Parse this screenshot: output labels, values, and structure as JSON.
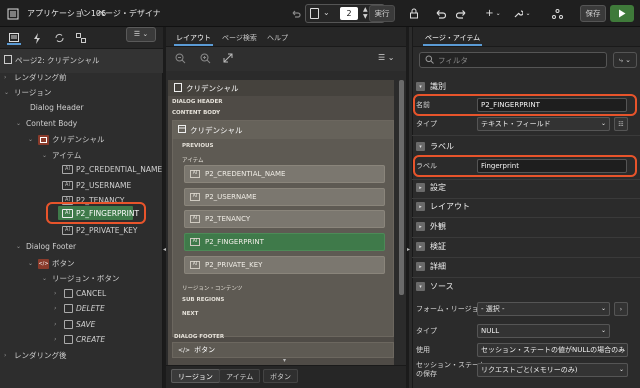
{
  "app": {
    "breadcrumb_app": "アプリケーション106",
    "breadcrumb_sep": "\\",
    "breadcrumb_tool": "ページ・デザイナ",
    "page_number": "2",
    "run_label": "実行",
    "save_label": "保存"
  },
  "left": {
    "page_title": "ページ2: クリデンシャル",
    "tree": {
      "before_render": "レンダリング前",
      "regions": "リージョン",
      "dialog_header": "Dialog Header",
      "content_body": "Content Body",
      "credential": "クリデンシャル",
      "items_label": "アイテム",
      "items": [
        "P2_CREDENTIAL_NAME",
        "P2_USERNAME",
        "P2_TENANCY",
        "P2_FINGERPRINT",
        "P2_PRIVATE_KEY"
      ],
      "dialog_footer": "Dialog Footer",
      "buttons_label": "ボタン",
      "region_buttons": "リージョン・ボタン",
      "buttons": [
        "CANCEL",
        "DELETE",
        "SAVE",
        "CREATE"
      ],
      "after_render": "レンダリング後"
    }
  },
  "middle": {
    "tabs": [
      "レイアウト",
      "ページ検索",
      "ヘルプ"
    ],
    "layout_title": "クリデンシャル",
    "dialog_header": "DIALOG HEADER",
    "content_body": "CONTENT BODY",
    "region_title": "クリデンシャル",
    "previous": "PREVIOUS",
    "items_caption": "アイテム",
    "items": [
      "P2_CREDENTIAL_NAME",
      "P2_USERNAME",
      "P2_TENANCY",
      "P2_FINGERPRINT",
      "P2_PRIVATE_KEY"
    ],
    "region_content": "リージョン・コンテンツ",
    "sub_regions": "SUB REGIONS",
    "next": "NEXT",
    "dialog_footer": "DIALOG FOOTER",
    "footer_button": "ボタン",
    "bottom_tabs": [
      "リージョン",
      "アイテム",
      "ボタン"
    ]
  },
  "right": {
    "tab": "ページ・アイテム",
    "filter_placeholder": "フィルタ",
    "groups": {
      "identification": "識別",
      "label": "ラベル",
      "settings": "設定",
      "layout": "レイアウト",
      "appearance": "外観",
      "validation": "検証",
      "advanced": "詳細",
      "source": "ソース"
    },
    "props": {
      "name_label": "名前",
      "name_value": "P2_FINGERPRINT",
      "type_label": "タイプ",
      "type_value": "テキスト・フィールド",
      "label_label": "ラベル",
      "label_value": "Fingerprint",
      "form_region_label": "フォーム・リージョン",
      "form_region_value": "- 選択 -",
      "source_type_label": "タイプ",
      "source_type_value": "NULL",
      "used_label": "使用",
      "used_value": "セッション・ステートの値がNULLの場合のみ",
      "session_label_1": "セッション・ステート",
      "session_label_2": "の保存",
      "session_value": "リクエストごと(メモリーのみ)"
    }
  },
  "colors": {
    "selected_green": "#3f7a4a",
    "highlight_orange": "#e8542b",
    "accent_blue": "#5b9bd5"
  }
}
